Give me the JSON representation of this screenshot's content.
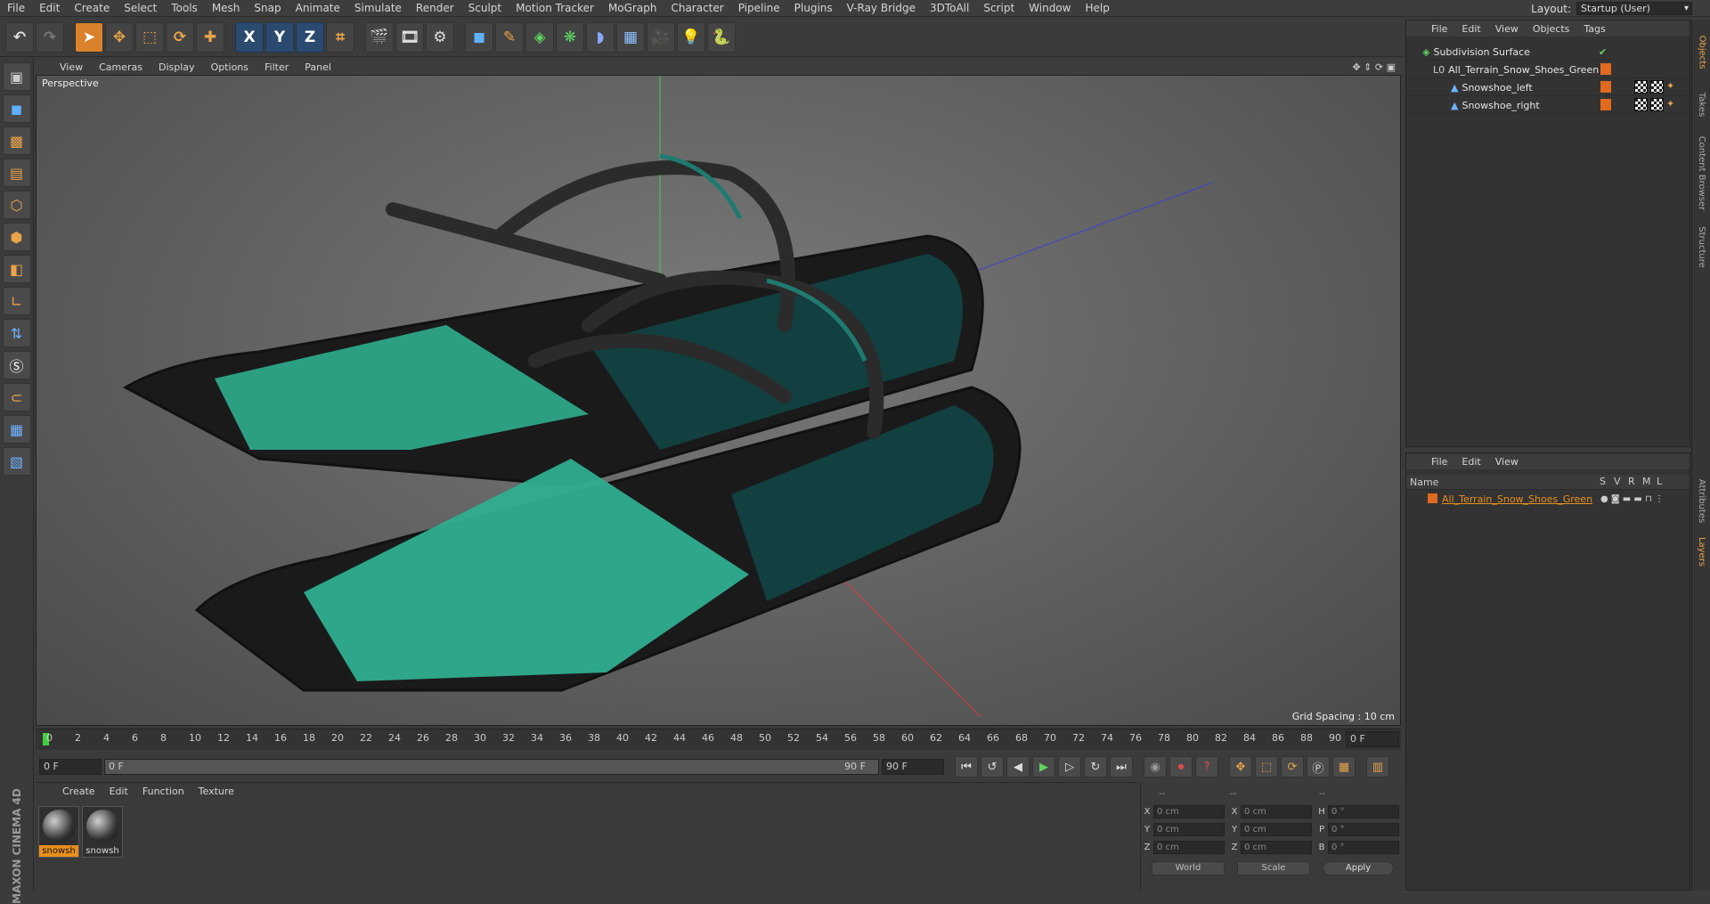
{
  "menubar": {
    "items": [
      "File",
      "Edit",
      "Create",
      "Select",
      "Tools",
      "Mesh",
      "Snap",
      "Animate",
      "Simulate",
      "Render",
      "Sculpt",
      "Motion Tracker",
      "MoGraph",
      "Character",
      "Pipeline",
      "Plugins",
      "V-Ray Bridge",
      "3DToAll",
      "Script",
      "Window",
      "Help"
    ],
    "layout_label": "Layout:",
    "layout_value": "Startup (User)"
  },
  "toolbar": {
    "icons": [
      "undo-icon",
      "redo-icon",
      "select-icon",
      "move-icon",
      "scale-icon",
      "rotate-icon",
      "add-icon",
      "x-axis-icon",
      "y-axis-icon",
      "z-axis-icon",
      "coord-icon",
      "render-view-icon",
      "render-icon",
      "render-settings-icon",
      "cube-icon",
      "pen-icon",
      "subdiv-icon",
      "cloner-icon",
      "deformer-icon",
      "floor-icon",
      "camera-icon",
      "light-icon",
      "python-icon"
    ],
    "axis_x": "X",
    "axis_y": "Y",
    "axis_z": "Z"
  },
  "viewport": {
    "menu": [
      "View",
      "Cameras",
      "Display",
      "Options",
      "Filter",
      "Panel"
    ],
    "label": "Perspective",
    "grid_spacing": "Grid Spacing : 10 cm",
    "accent": "#2fae8f"
  },
  "timeline": {
    "ticks": [
      "0",
      "2",
      "4",
      "6",
      "8",
      "10",
      "12",
      "14",
      "16",
      "18",
      "20",
      "22",
      "24",
      "26",
      "28",
      "30",
      "32",
      "34",
      "36",
      "38",
      "40",
      "42",
      "44",
      "46",
      "48",
      "50",
      "52",
      "54",
      "56",
      "58",
      "60",
      "62",
      "64",
      "66",
      "68",
      "70",
      "72",
      "74",
      "76",
      "78",
      "80",
      "82",
      "84",
      "86",
      "88",
      "90"
    ],
    "current_frame_field": "0 F"
  },
  "transport": {
    "start_field": "0 F",
    "range_start": "0 F",
    "range_end": "90 F",
    "end_field": "90 F"
  },
  "materials": {
    "menu": [
      "Create",
      "Edit",
      "Function",
      "Texture"
    ],
    "items": [
      {
        "name": "snowsh",
        "selected": true
      },
      {
        "name": "snowsh",
        "selected": false
      }
    ]
  },
  "coords": {
    "header_left": "--",
    "header_mid": "--",
    "header_right": "--",
    "rows": [
      {
        "a": "X",
        "av": "0 cm",
        "b": "X",
        "bv": "0 cm",
        "c": "H",
        "cv": "0 °"
      },
      {
        "a": "Y",
        "av": "0 cm",
        "b": "Y",
        "bv": "0 cm",
        "c": "P",
        "cv": "0 °"
      },
      {
        "a": "Z",
        "av": "0 cm",
        "b": "Z",
        "bv": "0 cm",
        "c": "B",
        "cv": "0 °"
      }
    ],
    "world": "World",
    "scale": "Scale",
    "apply": "Apply"
  },
  "objects": {
    "menu": [
      "File",
      "Edit",
      "View",
      "Objects",
      "Tags"
    ],
    "rows": [
      {
        "name": "Subdivision Surface",
        "indent": 0
      },
      {
        "name": "All_Terrain_Snow_Shoes_Green",
        "indent": 1
      },
      {
        "name": "Snowshoe_left",
        "indent": 2
      },
      {
        "name": "Snowshoe_right",
        "indent": 2
      }
    ]
  },
  "layers": {
    "menu": [
      "File",
      "Edit",
      "View"
    ],
    "header_name": "Name",
    "cols": [
      "S",
      "V",
      "R",
      "M",
      "L"
    ],
    "row_name": "All_Terrain_Snow_Shoes_Green"
  },
  "sidetabs": [
    "Objects",
    "Takes",
    "Content Browser",
    "Structure",
    "Attributes",
    "Layers"
  ],
  "brand": "MAXON CINEMA 4D"
}
